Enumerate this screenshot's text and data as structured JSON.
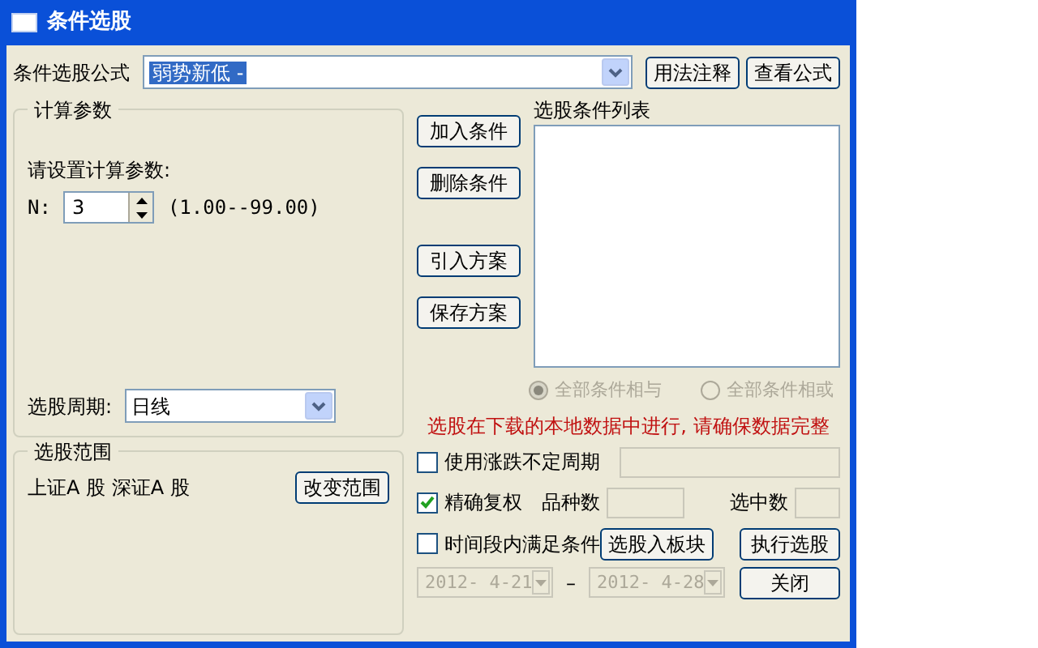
{
  "window": {
    "title": "条件选股"
  },
  "formula": {
    "label": "条件选股公式",
    "value": "弱势新低 -",
    "buttons": [
      "用法注释",
      "查看公式"
    ]
  },
  "params": {
    "title": "计算参数",
    "prompt": "请设置计算参数:",
    "rows": [
      {
        "label": "N:",
        "value": "3",
        "range": "(1.00--99.00)"
      }
    ],
    "period_label": "选股周期:",
    "period_value": "日线"
  },
  "scope": {
    "title": "选股范围",
    "text": "上证A 股 深证A 股",
    "button": "改变范围"
  },
  "side_buttons": [
    "加入条件",
    "删除条件",
    "引入方案",
    "保存方案"
  ],
  "condition_list": {
    "label": "选股条件列表"
  },
  "logic": [
    {
      "label": "全部条件相与",
      "selected": true,
      "disabled": true
    },
    {
      "label": "全部条件相或",
      "selected": false,
      "disabled": true
    }
  ],
  "notice": "选股在下载的本地数据中进行, 请确保数据完整",
  "options": [
    {
      "label": "使用涨跌不定周期",
      "checked": false
    },
    {
      "label": "精确复权",
      "checked": true
    },
    {
      "label": "时间段内满足条件",
      "checked": false
    }
  ],
  "counts": [
    {
      "label": "品种数"
    },
    {
      "label": "选中数"
    }
  ],
  "dates": {
    "from": "2012- 4-21",
    "separator": "–",
    "to": "2012- 4-28"
  },
  "actions": {
    "to_block": "选股入板块",
    "run": "执行选股",
    "close": "关闭"
  }
}
